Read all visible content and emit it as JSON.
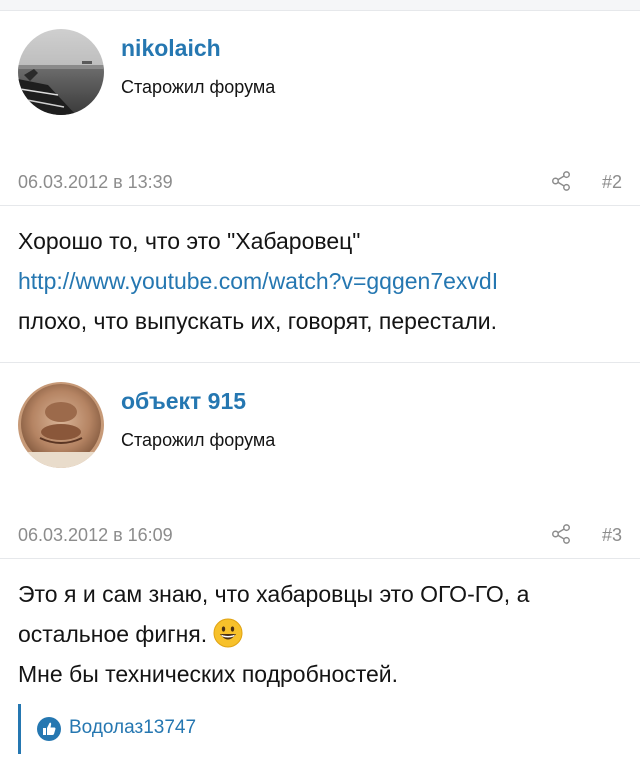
{
  "posts": [
    {
      "username": "nikolaich",
      "user_title": "Старожил форума",
      "date": "06.03.2012 в 13:39",
      "number": "#2",
      "text_line1": "Хорошо то, что это \"Хабаровец\"",
      "link": "http://www.youtube.com/watch?v=gqgen7exvdI",
      "text_line3": "плохо, что выпускать их, говорят, перестали."
    },
    {
      "username": "объект 915",
      "user_title": "Старожил форума",
      "date": "06.03.2012 в 16:09",
      "number": "#3",
      "text_line1": "Это я и сам знаю, что хабаровцы это ОГО-ГО, а",
      "text_line2": "остальное фигня.",
      "text_line3": "Мне бы технических подробностей.",
      "likes": [
        "Водолаз13747"
      ]
    }
  ],
  "icons": {
    "share": "share-icon",
    "like": "thumbs-up-icon",
    "emoji": "grinning-face-emoji"
  },
  "colors": {
    "accent": "#2577b1",
    "meta": "#8c8c8c"
  }
}
